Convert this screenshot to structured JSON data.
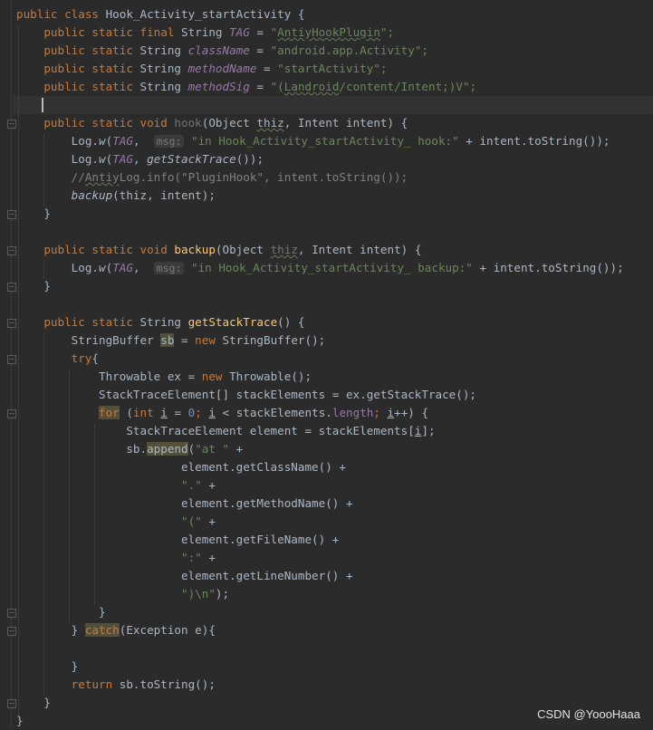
{
  "code": {
    "l0": {
      "t1": "public class ",
      "t2": "Hook_Activity_startActivity {"
    },
    "l1": {
      "t1": "public static final ",
      "t2": "String ",
      "t3": "TAG",
      "t4": " = ",
      "t5": "\"",
      "t6": "AntiyHookPlugin",
      "t7": "\";"
    },
    "l2": {
      "t1": "public static ",
      "t2": "String ",
      "t3": "className",
      "t4": " = ",
      "t5": "\"android.app.Activity\";"
    },
    "l3": {
      "t1": "public static ",
      "t2": "String ",
      "t3": "methodName",
      "t4": " = ",
      "t5": "\"startActivity\";"
    },
    "l4": {
      "t1": "public static ",
      "t2": "String ",
      "t3": "methodSig",
      "t4": " = ",
      "t5": "\"(",
      "t6": "Landroid",
      "t7": "/content/Intent;)V\";"
    },
    "l6": {
      "t1": "public static void ",
      "t2": "hook",
      "t3": "(Object ",
      "t4": "thiz",
      ",": ",",
      "t5": ", Intent intent) {"
    },
    "l7": {
      "t1": "Log.",
      "t2": "w",
      "t3": "(",
      "t4": "TAG",
      "t5": ",  ",
      "t6": "msg:",
      "t7": " ",
      "t8": "\"in Hook_Activity_startActivity_ hook:\"",
      "t9": " + intent.toString());"
    },
    "l8": {
      "t1": "Log.",
      "t2": "w",
      "t3": "(",
      "t4": "TAG",
      "t5": ", ",
      "t6": "getStackTrace",
      "t7": "());"
    },
    "l9": {
      "t1": "//",
      "t2": "Antiy",
      "t3": "Log.info(\"PluginHook\", intent.toString());"
    },
    "l10": {
      "t1": "backup",
      "t2": "(thiz, intent);"
    },
    "l11": {
      "t1": "}"
    },
    "l13": {
      "t1": "public static void ",
      "t2": "backup",
      "t3": "(Object ",
      "t4": "thiz",
      "t5": ", Intent intent) {"
    },
    "l14": {
      "t1": "Log.",
      "t2": "w",
      "t3": "(",
      "t4": "TAG",
      "t5": ",  ",
      "t6": "msg:",
      "t7": " ",
      "t8": "\"in Hook_Activity_startActivity_ backup:\"",
      "t9": " + intent.toString());"
    },
    "l15": {
      "t1": "}"
    },
    "l17": {
      "t1": "public static ",
      "t2": "String ",
      "t3": "getStackTrace",
      "t4": "() {"
    },
    "l18": {
      "t1": "StringBuffer ",
      "t2": "sb",
      "t3": " = ",
      "t4": "new ",
      "t5": "StringBuffer();"
    },
    "l19": {
      "t1": "try",
      "t2": "{"
    },
    "l20": {
      "t1": "Throwable ex = ",
      "t2": "new ",
      "t3": "Throwable();"
    },
    "l21": {
      "t1": "StackTraceElement[] stackElements = ex.getStackTrace();"
    },
    "l22": {
      "t1": "for",
      "t2": " (",
      "t3": "int ",
      "t4": "i",
      "t5": " = ",
      "t6": "0",
      "t7": "; ",
      "t8": "i",
      "t9": " < stackElements.",
      "t10": "length",
      "t11": "; ",
      "t12": "i",
      "t13": "++) {"
    },
    "l23": {
      "t1": "StackTraceElement element = stackElements[",
      "t2": "i",
      "t3": "];"
    },
    "l24": {
      "t1": "sb.",
      "t2": "append",
      "t3": "(",
      "t4": "\"at \"",
      "t5": " +"
    },
    "l25": {
      "t1": "element.getClassName() +"
    },
    "l26": {
      "t1": "\".\"",
      "t2": " +"
    },
    "l27": {
      "t1": "element.getMethodName() +"
    },
    "l28": {
      "t1": "\"(\"",
      "t2": " +"
    },
    "l29": {
      "t1": "element.getFileName() +"
    },
    "l30": {
      "t1": "\":\"",
      "t2": " +"
    },
    "l31": {
      "t1": "element.getLineNumber() +"
    },
    "l32": {
      "t1": "\")\\n\"",
      "t2": ");"
    },
    "l33": {
      "t1": "}"
    },
    "l34": {
      "t1": "} ",
      "t2": "catch",
      "t3": "(Exception e){"
    },
    "l36": {
      "t1": "}"
    },
    "l37": {
      "t1": "return ",
      "t2": "sb.toString();"
    },
    "l38": {
      "t1": "}"
    },
    "l39": {
      "t1": "}"
    }
  },
  "watermark": "CSDN @YoooHaaa",
  "colors": {
    "background": "#2b2b2b",
    "keyword": "#cc7832",
    "string": "#6a8759",
    "field": "#9876aa",
    "method_decl": "#ffc66d",
    "number": "#6897bb",
    "comment": "#808080"
  }
}
